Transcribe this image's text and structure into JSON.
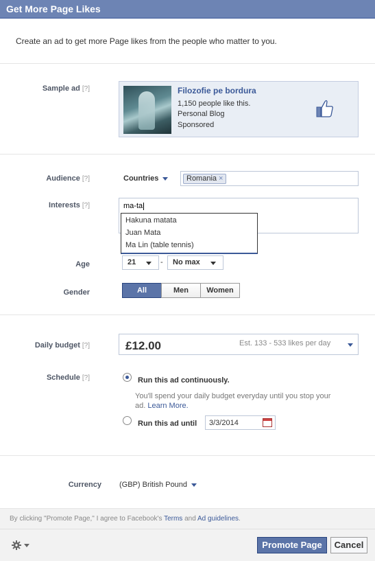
{
  "dialog": {
    "title": "Get More Page Likes"
  },
  "intro": "Create an ad to get more Page likes from the people who matter to you.",
  "help_marker": "[?]",
  "sample_ad": {
    "label": "Sample ad",
    "page_name": "Filozofie pe bordura",
    "likes_text": "1,150 people like this.",
    "category": "Personal Blog",
    "sponsored": "Sponsored"
  },
  "audience": {
    "label": "Audience",
    "selector": "Countries",
    "tokens": [
      "Romania"
    ],
    "token_remove": "×"
  },
  "interests": {
    "label": "Interests",
    "value": "ma-ta",
    "suggestions": [
      "Hakuna matata",
      "Juan Mata",
      "Ma Lin (table tennis)"
    ]
  },
  "age": {
    "label": "Age",
    "min": "21",
    "separator": "-",
    "max": "No max"
  },
  "gender": {
    "label": "Gender",
    "options": [
      "All",
      "Men",
      "Women"
    ],
    "selected": "All"
  },
  "budget": {
    "label": "Daily budget",
    "value": "£12.00",
    "estimate": "Est. 133 - 533 likes per day"
  },
  "schedule": {
    "label": "Schedule",
    "continuous_label": "Run this ad continuously.",
    "note": "You'll spend your daily budget everyday until you stop your ad.",
    "learn_more": "Learn More.",
    "until_label": "Run this ad until",
    "until_date": "3/3/2014"
  },
  "currency": {
    "label": "Currency",
    "value": "(GBP) British Pound"
  },
  "terms": {
    "prefix": "By clicking \"Promote Page,\" I agree to Facebook's",
    "terms_link": "Terms",
    "and": "and",
    "guidelines_link": "Ad guidelines",
    "suffix": "."
  },
  "buttons": {
    "promote": "Promote Page",
    "cancel": "Cancel"
  },
  "colors": {
    "brand": "#3b5998",
    "header": "#6d84b4",
    "button": "#5b74a8"
  }
}
